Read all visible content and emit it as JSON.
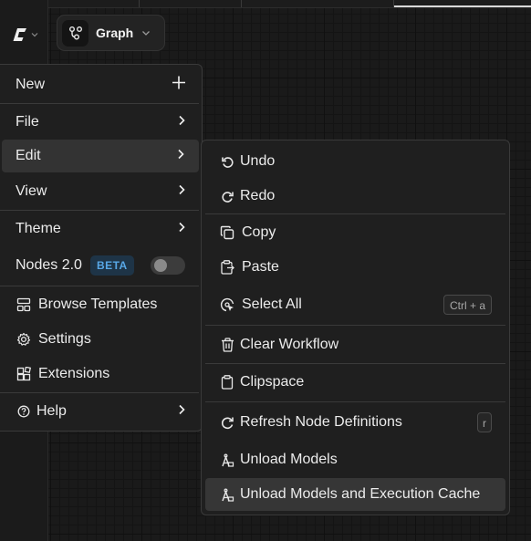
{
  "header": {
    "graph_label": "Graph"
  },
  "main_menu": {
    "new": "New",
    "file": "File",
    "edit": "Edit",
    "view": "View",
    "theme": "Theme",
    "nodes2": "Nodes 2.0",
    "beta": "BETA",
    "nodes2_enabled": false,
    "browse_templates": "Browse Templates",
    "settings": "Settings",
    "extensions": "Extensions",
    "help": "Help"
  },
  "edit_menu": {
    "undo": "Undo",
    "redo": "Redo",
    "copy": "Copy",
    "paste": "Paste",
    "select_all": "Select All",
    "select_all_shortcut": "Ctrl + a",
    "clear_workflow": "Clear Workflow",
    "clipspace": "Clipspace",
    "refresh_node_definitions": "Refresh Node Definitions",
    "refresh_shortcut": "r",
    "unload_models": "Unload Models",
    "unload_models_and_cache": "Unload Models and Execution Cache"
  },
  "colors": {
    "background": "#1a1a1a",
    "menu": "#1f1f1f",
    "highlight": "#333333",
    "beta_text": "#58a7e6",
    "beta_bg": "#1e3447"
  }
}
